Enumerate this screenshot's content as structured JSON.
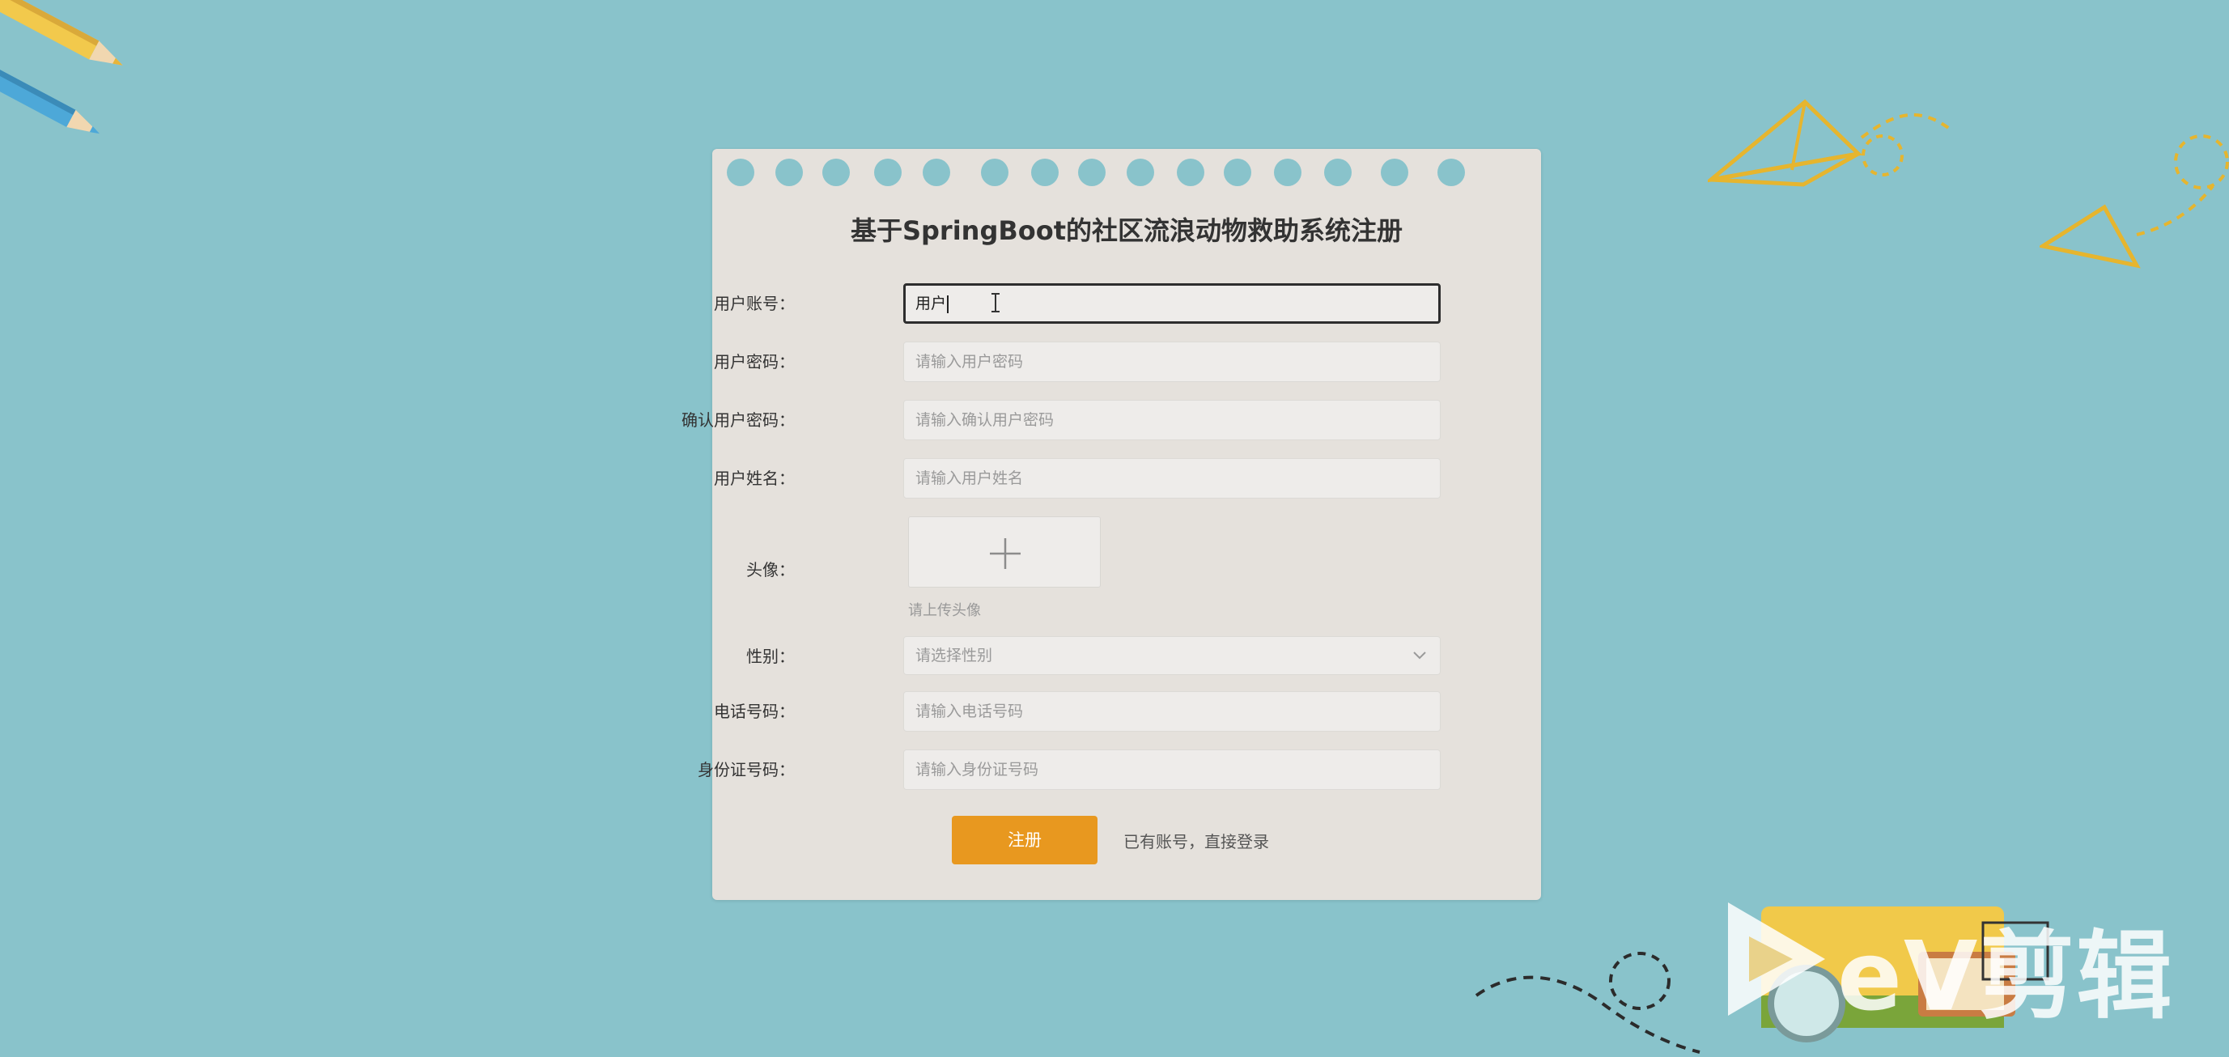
{
  "form": {
    "title": "基于SpringBoot的社区流浪动物救助系统注册",
    "fields": [
      {
        "label": "用户账号：",
        "value": "用户",
        "placeholder": ""
      },
      {
        "label": "用户密码：",
        "value": "",
        "placeholder": "请输入用户密码"
      },
      {
        "label": "确认用户密码：",
        "value": "",
        "placeholder": "请输入确认用户密码"
      },
      {
        "label": "用户姓名：",
        "value": "",
        "placeholder": "请输入用户姓名"
      },
      {
        "label": "性别：",
        "value": "",
        "placeholder": "请选择性别"
      },
      {
        "label": "电话号码：",
        "value": "",
        "placeholder": "请输入电话号码"
      },
      {
        "label": "身份证号码：",
        "value": "",
        "placeholder": "请输入身份证号码"
      }
    ],
    "avatar": {
      "label": "头像：",
      "tip": "请上传头像"
    },
    "register_label": "注册",
    "login_link": "已有账号，直接登录"
  },
  "watermark": "eV剪辑",
  "colors": {
    "background": "#89c3cb",
    "card": "#e5e1dc",
    "accent": "#e8981f"
  },
  "icons": [
    "text-cursor-icon",
    "plus-icon",
    "chevron-down-icon",
    "pencil-icon",
    "paper-plane-icon",
    "book-icon"
  ]
}
